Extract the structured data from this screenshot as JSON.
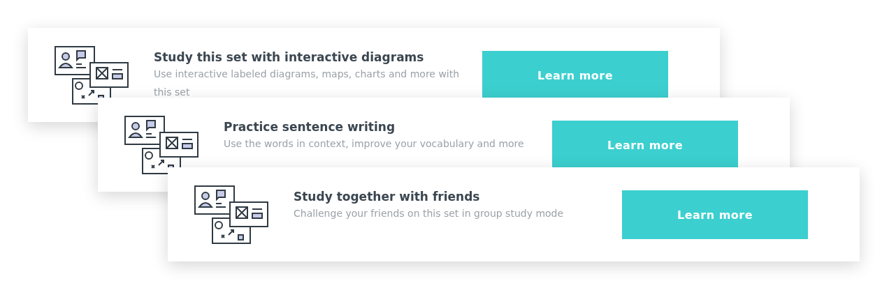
{
  "cards": [
    {
      "title": "Study this set with interactive diagrams",
      "description": "Use interactive labeled diagrams, maps, charts and more with this set",
      "button": "Learn more"
    },
    {
      "title": "Practice sentence writing",
      "description": "Use the words in context, improve your vocabulary and more",
      "button": "Learn more"
    },
    {
      "title": "Study together with friends",
      "description": "Challenge your friends on this set in group study mode",
      "button": "Learn more"
    }
  ]
}
